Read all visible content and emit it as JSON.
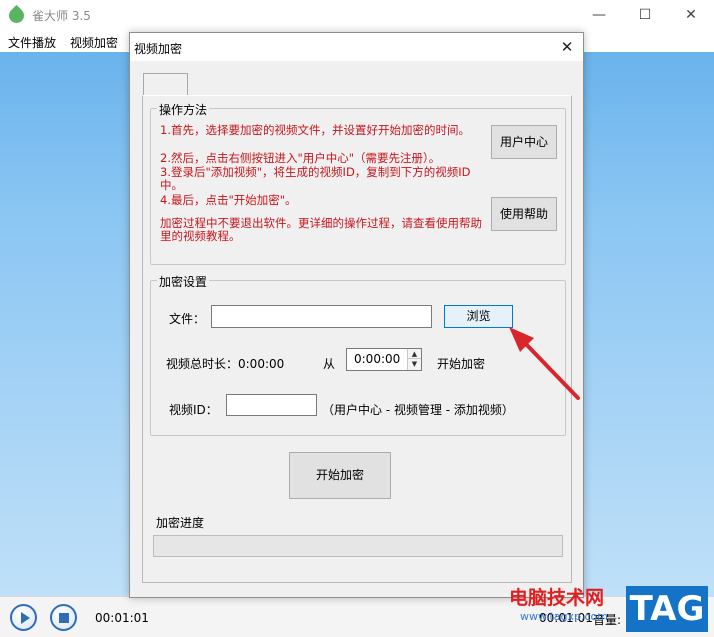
{
  "app": {
    "title": "雀大师 3.5",
    "window_controls": {
      "minimize": "—",
      "maximize": "☐",
      "close": "✕"
    }
  },
  "menu": [
    "文件播放",
    "视频加密"
  ],
  "dialog": {
    "title": "视频加密",
    "close": "✕",
    "howto": {
      "legend": "操作方法",
      "steps": [
        "1.首先，选择要加密的视频文件，并设置好开始加密的时间。",
        "2.然后，点击右侧按钮进入\"用户中心\"（需要先注册）。",
        "3.登录后\"添加视频\"，将生成的视频ID，复制到下方的视频ID中。",
        "4.最后，点击\"开始加密\"。"
      ],
      "note": "加密过程中不要退出软件。更详细的操作过程，请查看使用帮助里的视频教程。",
      "user_center_button": "用户中心",
      "help_button": "使用帮助"
    },
    "settings": {
      "legend": "加密设置",
      "file_label": "文件：",
      "file_value": "",
      "browse_button": "浏览",
      "duration_label": "视频总时长：0:00:00",
      "from_label": "从",
      "start_time": "0:00:00",
      "start_encrypt_label": "开始加密",
      "video_id_label": "视频ID：",
      "video_id_value": "",
      "video_id_hint": "（用户中心 - 视频管理 - 添加视频）"
    },
    "start_button": "开始加密",
    "progress": {
      "label": "加密进度",
      "percent": 0
    }
  },
  "player": {
    "elapsed": "00:01:01",
    "time_right": "00:01:01",
    "volume_label": "音量:"
  },
  "watermark": {
    "site_name": "电脑技术网",
    "url": "www.tagxp.com",
    "badge": "TAG"
  },
  "colors": {
    "instruction_text": "#c8161d",
    "annotation_arrow": "#d9262c",
    "focus_border": "#0078d7",
    "progress_fill": "#06b025"
  }
}
